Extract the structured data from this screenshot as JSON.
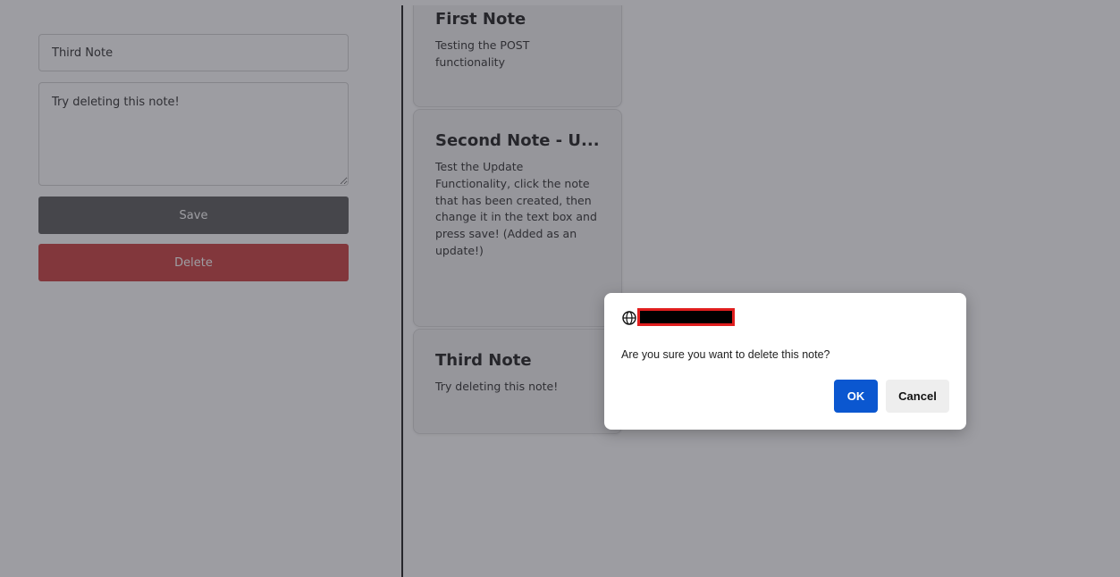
{
  "editor": {
    "title_value": "Third Note",
    "body_value": "Try deleting this note!",
    "save_label": "Save",
    "delete_label": "Delete"
  },
  "notes": [
    {
      "title": "First Note",
      "body": "Testing the POST functionality"
    },
    {
      "title": "Second Note - U...",
      "body": "Test the Update Functionality, click the note that has been created, then change it in the text box and press save! (Added as an update!)"
    },
    {
      "title": "Third Note",
      "body": "Try deleting this note!"
    }
  ],
  "dialog": {
    "icon": "globe-icon",
    "message": "Are you sure you want to delete this note?",
    "ok_label": "OK",
    "cancel_label": "Cancel"
  },
  "colors": {
    "save_button": "#505050",
    "delete_button": "#c83232",
    "ok_button": "#0b57d0",
    "redaction_border": "#e01e1e"
  }
}
